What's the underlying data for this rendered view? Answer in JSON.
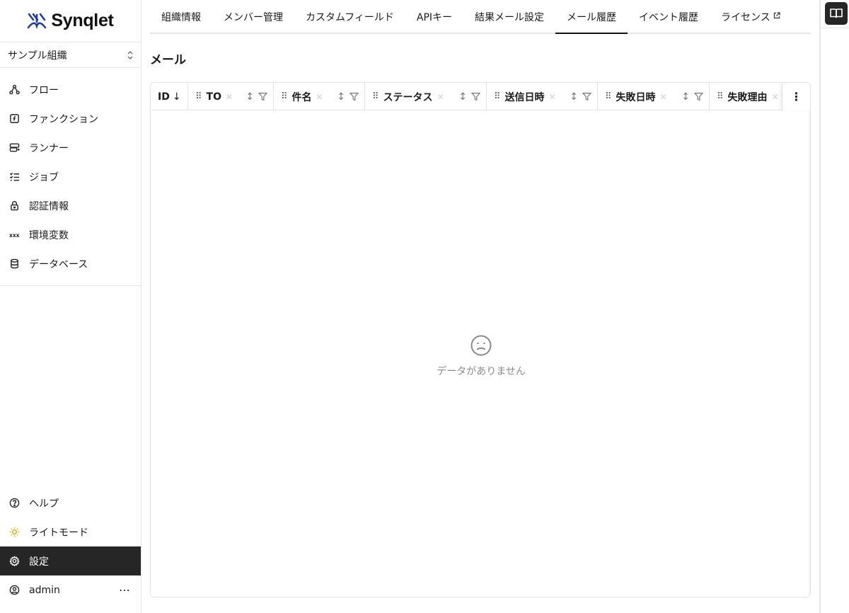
{
  "app": {
    "name": "Synqlet"
  },
  "org_select": {
    "value": "サンプル組織"
  },
  "nav": {
    "items": [
      {
        "label": "フロー",
        "icon": "flow-icon"
      },
      {
        "label": "ファンクション",
        "icon": "function-icon"
      },
      {
        "label": "ランナー",
        "icon": "runner-icon"
      },
      {
        "label": "ジョブ",
        "icon": "jobs-icon"
      },
      {
        "label": "認証情報",
        "icon": "lock-icon"
      },
      {
        "label": "環境変数",
        "icon": "variables-icon"
      },
      {
        "label": "データベース",
        "icon": "database-icon"
      }
    ],
    "bottom": [
      {
        "label": "ヘルプ",
        "icon": "help-icon"
      },
      {
        "label": "ライトモード",
        "icon": "sun-icon"
      },
      {
        "label": "設定",
        "icon": "gear-icon",
        "active": true
      },
      {
        "label": "admin",
        "icon": "user-icon"
      }
    ]
  },
  "tabs": [
    {
      "label": "組織情報"
    },
    {
      "label": "メンバー管理"
    },
    {
      "label": "カスタムフィールド"
    },
    {
      "label": "APIキー"
    },
    {
      "label": "結果メール設定"
    },
    {
      "label": "メール履歴",
      "active": true
    },
    {
      "label": "イベント履歴"
    },
    {
      "label": "ライセンス",
      "external": true
    }
  ],
  "page": {
    "title": "メール"
  },
  "table": {
    "columns": [
      {
        "label": "ID",
        "sort": "↓"
      },
      {
        "label": "TO"
      },
      {
        "label": "件名"
      },
      {
        "label": "ステータス"
      },
      {
        "label": "送信日時"
      },
      {
        "label": "失敗日時"
      },
      {
        "label": "失敗理由"
      }
    ],
    "empty_message": "データがありません"
  },
  "colors": {
    "active_nav_bg": "#262626",
    "sun_icon": "#e0a800",
    "logo_blue": "#1f3f9a"
  }
}
